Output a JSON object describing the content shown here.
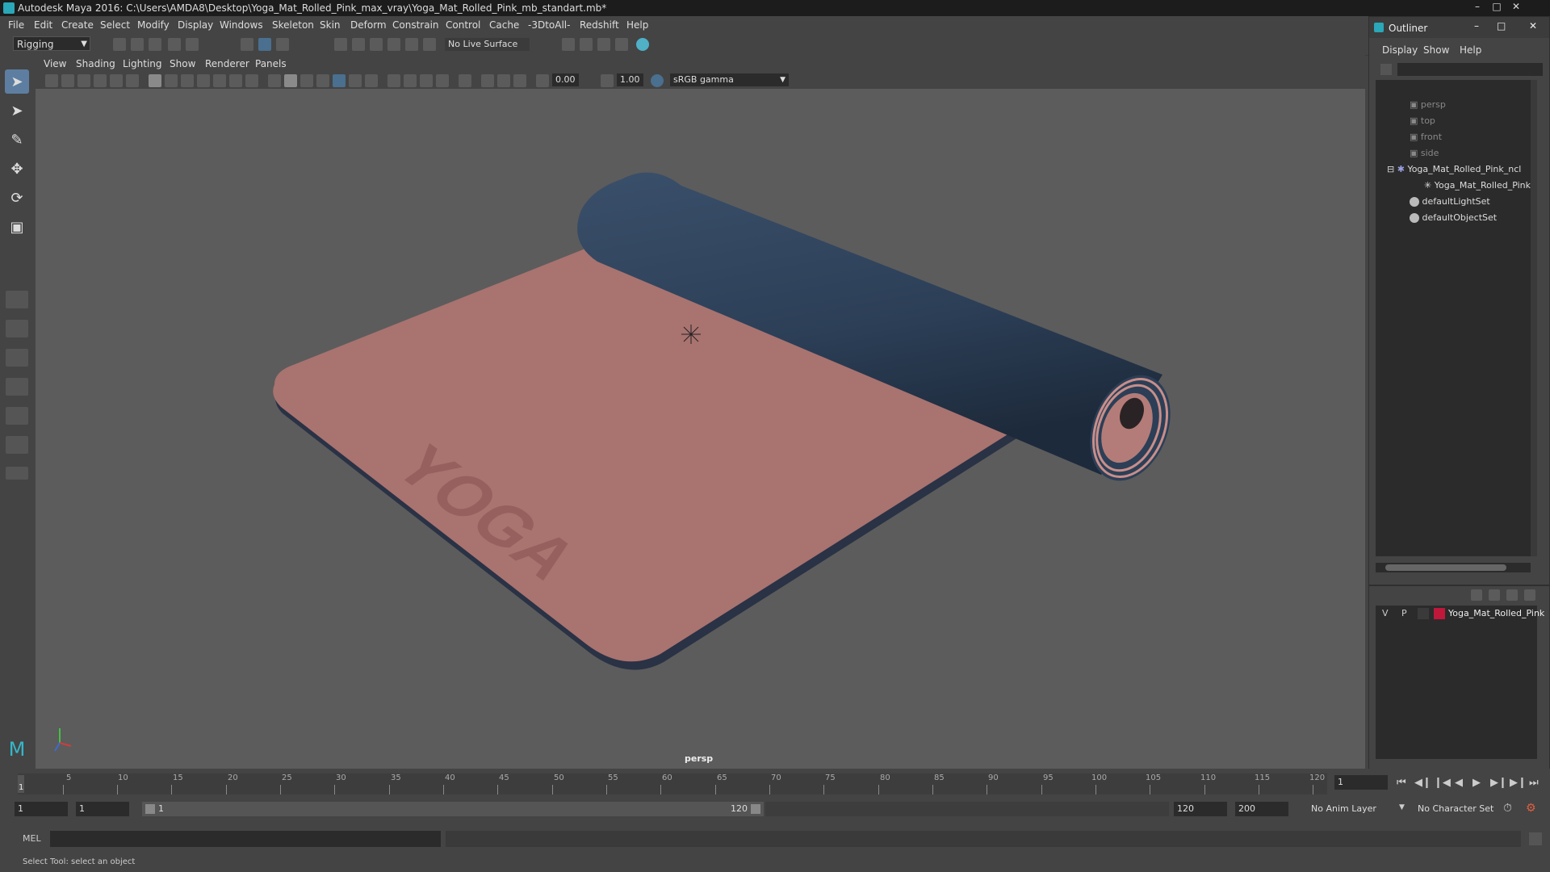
{
  "window": {
    "title": "Autodesk Maya 2016: C:\\Users\\AMDA8\\Desktop\\Yoga_Mat_Rolled_Pink_max_vray\\Yoga_Mat_Rolled_Pink_mb_standart.mb*"
  },
  "menu": [
    "File",
    "Edit",
    "Create",
    "Select",
    "Modify",
    "Display",
    "Windows",
    "Skeleton",
    "Skin",
    "Deform",
    "Constrain",
    "Control",
    "Cache",
    "-3DtoAll-",
    "Redshift",
    "Help"
  ],
  "shelf": {
    "mode": "Rigging",
    "live_surface": "No Live Surface"
  },
  "viewport": {
    "menu": [
      "View",
      "Shading",
      "Lighting",
      "Show",
      "Renderer",
      "Panels"
    ],
    "exposure": "0.00",
    "gamma_value": "1.00",
    "color_space": "sRGB gamma",
    "camera_label": "persp",
    "mat_text": "YOGA",
    "colors": {
      "mat_top": "#a97370",
      "mat_roll": "#2c3f57",
      "background": "#5c5c5c"
    }
  },
  "outliner": {
    "title": "Outliner",
    "menu": [
      "Display",
      "Show",
      "Help"
    ],
    "items": [
      {
        "label": "persp"
      },
      {
        "label": "top"
      },
      {
        "label": "front"
      },
      {
        "label": "side"
      },
      {
        "label": "Yoga_Mat_Rolled_Pink_ncl"
      },
      {
        "label": "Yoga_Mat_Rolled_Pink"
      },
      {
        "label": "defaultLightSet"
      },
      {
        "label": "defaultObjectSet"
      }
    ]
  },
  "layers": {
    "v": "V",
    "p": "P",
    "name": "Yoga_Mat_Rolled_Pink",
    "color": "#c0183a"
  },
  "timeline": {
    "ticks": [
      "5",
      "10",
      "15",
      "20",
      "25",
      "30",
      "35",
      "40",
      "45",
      "50",
      "55",
      "60",
      "65",
      "70",
      "75",
      "80",
      "85",
      "90",
      "95",
      "100",
      "105",
      "110",
      "115",
      "120"
    ],
    "current_marker": "1",
    "current_frame": "1"
  },
  "range": {
    "start": "1",
    "playback_start": "1",
    "slider_start": "1",
    "slider_end": "120",
    "playback_end": "120",
    "end": "200",
    "anim_layer": "No Anim Layer",
    "char_set": "No Character Set"
  },
  "command": {
    "mode": "MEL"
  },
  "help": {
    "text": "Select Tool: select an object"
  }
}
